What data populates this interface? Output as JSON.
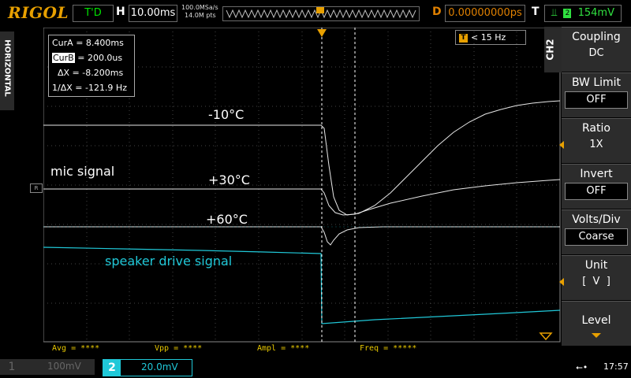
{
  "top": {
    "brand": "RIGOL",
    "run_state": "T'D",
    "h_label": "H",
    "h_scale": "10.00ms",
    "sample_rate": "100.0MSa/s",
    "mem_depth": "14.0M pts",
    "d_label": "D",
    "delay": "0.00000000ps",
    "t_label": "T",
    "trigger_level": "154mV"
  },
  "side_label": "HORIZONTAL",
  "cursor": {
    "cur_a": "CurA = 8.400ms",
    "cur_b_label": "CurB",
    "cur_b_value": " = 200.0us",
    "delta_x": "  ΔX = -8.200ms",
    "inv_delta_x": "1/ΔX = -121.9 Hz"
  },
  "filter": {
    "icon": "T",
    "label": "< 15 Hz"
  },
  "annotations": {
    "minus10": "-10°C",
    "mic": "mic signal",
    "plus30": "+30°C",
    "plus60": "+60°C",
    "speaker": "speaker drive signal"
  },
  "measurements": {
    "avg": "Avg = ****",
    "vpp": "Vpp = ****",
    "ampl": "Ampl = ****",
    "freq": "Freq = *****"
  },
  "channel_tab": "CH2",
  "menu": {
    "coupling": {
      "label": "Coupling",
      "value": "DC"
    },
    "bw_limit": {
      "label": "BW Limit",
      "value": "OFF"
    },
    "ratio": {
      "label": "Ratio",
      "value": "1X"
    },
    "invert": {
      "label": "Invert",
      "value": "OFF"
    },
    "volts_div": {
      "label": "Volts/Div",
      "value": "Coarse"
    },
    "unit": {
      "label": "Unit",
      "value": "[  V  ]"
    },
    "level": {
      "label": "Level"
    }
  },
  "bottom": {
    "ch1_num": "1",
    "ch1_scale": "100mV",
    "ch2_num": "2",
    "ch2_scale": "20.0mV",
    "clock": "17:57"
  },
  "colors": {
    "trace": "#ffffff",
    "ch2": "#20c8d8",
    "accent": "#e8a000",
    "trigger": "#30e040"
  }
}
